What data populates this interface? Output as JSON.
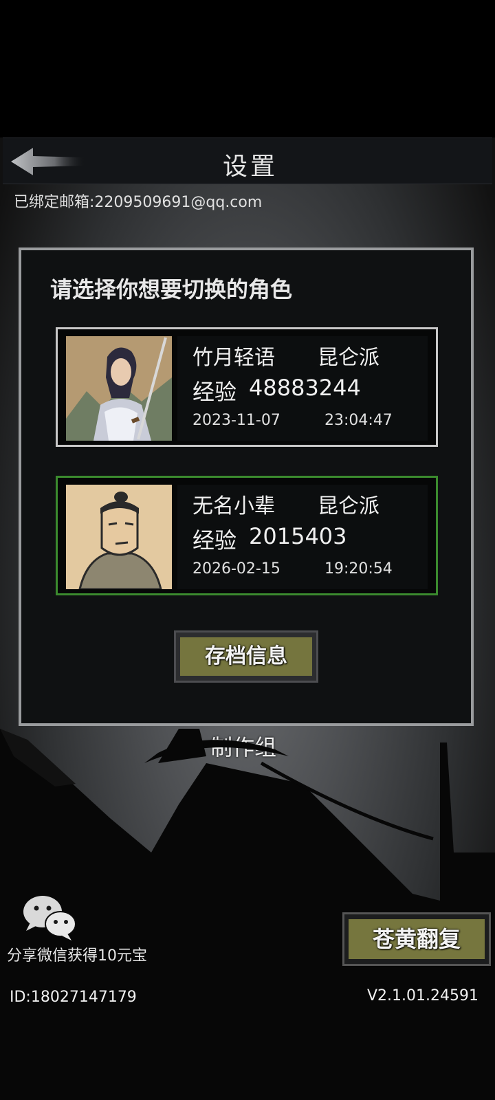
{
  "header": {
    "title": "设置"
  },
  "account": {
    "email_text": "已绑定邮箱:2209509691@qq.com"
  },
  "role_panel": {
    "title": "请选择你想要切换的角色",
    "roles": [
      {
        "name": "竹月轻语",
        "sect": "昆仑派",
        "exp_label": "经验",
        "exp": "48883244",
        "date": "2023-11-07",
        "time": "23:04:47",
        "portrait": "female-swordswoman-portrait"
      },
      {
        "name": "无名小辈",
        "sect": "昆仑派",
        "exp_label": "经验",
        "exp": "2015403",
        "date": "2026-02-15",
        "time": "19:20:54",
        "portrait": "male-novice-portrait"
      }
    ],
    "save_info_label": "存档信息"
  },
  "credits_label": "制作组",
  "share": {
    "text": "分享微信获得10元宝",
    "icon": "wechat-icon"
  },
  "restore_label": "苍黄翻复",
  "footer": {
    "user_id": "ID:18027147179",
    "version": "V2.1.01.24591"
  },
  "colors": {
    "selected_border": "#c8c8c8",
    "alt_border": "#3b8b2e",
    "button_fill": "#75753e"
  }
}
